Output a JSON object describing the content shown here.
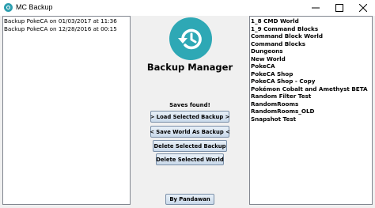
{
  "window": {
    "title": "MC Backup",
    "controls": {
      "minimize": "—",
      "maximize": "☐",
      "close": "✕"
    }
  },
  "backups": {
    "items": [
      "Backup PokeCA on 01/03/2017 at 11:36",
      "Backup PokeCA on 12/28/2016 at 00:15"
    ]
  },
  "header": {
    "app_name": "Backup Manager"
  },
  "status": {
    "text": "Saves found!"
  },
  "actions": {
    "load": "> Load Selected Backup >",
    "save": "< Save World As Backup <",
    "delete_backup": "Delete Selected Backup",
    "delete_world": "Delete Selected World",
    "credit": "By Pandawan"
  },
  "worlds": {
    "items": [
      "1_8 CMD World",
      "1_9 Command Blocks",
      "Command Block World",
      "Command Blocks",
      "Dungeons",
      "New World",
      "PokeCA",
      "PokeCA Shop",
      "PokeCA Shop - Copy",
      "Pokémon Cobalt and Amethyst BETA",
      "Random Filter Test",
      "RandomRooms",
      "RandomRooms_OLD",
      "Snapshot Test"
    ]
  },
  "colors": {
    "accent": "#2ea8b5",
    "button_top": "#e8f0f8",
    "button_bottom": "#c9d9ea",
    "window_bg": "#f0f0f0"
  },
  "icons": {
    "app": "backup-restore-icon",
    "logo": "history-clock-icon"
  }
}
